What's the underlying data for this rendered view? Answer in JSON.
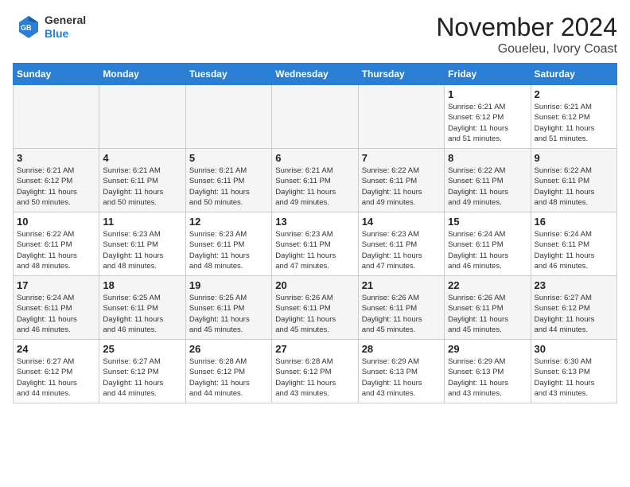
{
  "header": {
    "logo_line1": "General",
    "logo_line2": "Blue",
    "month": "November 2024",
    "location": "Goueleu, Ivory Coast"
  },
  "days_of_week": [
    "Sunday",
    "Monday",
    "Tuesday",
    "Wednesday",
    "Thursday",
    "Friday",
    "Saturday"
  ],
  "weeks": [
    [
      {
        "day": "",
        "info": ""
      },
      {
        "day": "",
        "info": ""
      },
      {
        "day": "",
        "info": ""
      },
      {
        "day": "",
        "info": ""
      },
      {
        "day": "",
        "info": ""
      },
      {
        "day": "1",
        "info": "Sunrise: 6:21 AM\nSunset: 6:12 PM\nDaylight: 11 hours\nand 51 minutes."
      },
      {
        "day": "2",
        "info": "Sunrise: 6:21 AM\nSunset: 6:12 PM\nDaylight: 11 hours\nand 51 minutes."
      }
    ],
    [
      {
        "day": "3",
        "info": "Sunrise: 6:21 AM\nSunset: 6:12 PM\nDaylight: 11 hours\nand 50 minutes."
      },
      {
        "day": "4",
        "info": "Sunrise: 6:21 AM\nSunset: 6:11 PM\nDaylight: 11 hours\nand 50 minutes."
      },
      {
        "day": "5",
        "info": "Sunrise: 6:21 AM\nSunset: 6:11 PM\nDaylight: 11 hours\nand 50 minutes."
      },
      {
        "day": "6",
        "info": "Sunrise: 6:21 AM\nSunset: 6:11 PM\nDaylight: 11 hours\nand 49 minutes."
      },
      {
        "day": "7",
        "info": "Sunrise: 6:22 AM\nSunset: 6:11 PM\nDaylight: 11 hours\nand 49 minutes."
      },
      {
        "day": "8",
        "info": "Sunrise: 6:22 AM\nSunset: 6:11 PM\nDaylight: 11 hours\nand 49 minutes."
      },
      {
        "day": "9",
        "info": "Sunrise: 6:22 AM\nSunset: 6:11 PM\nDaylight: 11 hours\nand 48 minutes."
      }
    ],
    [
      {
        "day": "10",
        "info": "Sunrise: 6:22 AM\nSunset: 6:11 PM\nDaylight: 11 hours\nand 48 minutes."
      },
      {
        "day": "11",
        "info": "Sunrise: 6:23 AM\nSunset: 6:11 PM\nDaylight: 11 hours\nand 48 minutes."
      },
      {
        "day": "12",
        "info": "Sunrise: 6:23 AM\nSunset: 6:11 PM\nDaylight: 11 hours\nand 48 minutes."
      },
      {
        "day": "13",
        "info": "Sunrise: 6:23 AM\nSunset: 6:11 PM\nDaylight: 11 hours\nand 47 minutes."
      },
      {
        "day": "14",
        "info": "Sunrise: 6:23 AM\nSunset: 6:11 PM\nDaylight: 11 hours\nand 47 minutes."
      },
      {
        "day": "15",
        "info": "Sunrise: 6:24 AM\nSunset: 6:11 PM\nDaylight: 11 hours\nand 46 minutes."
      },
      {
        "day": "16",
        "info": "Sunrise: 6:24 AM\nSunset: 6:11 PM\nDaylight: 11 hours\nand 46 minutes."
      }
    ],
    [
      {
        "day": "17",
        "info": "Sunrise: 6:24 AM\nSunset: 6:11 PM\nDaylight: 11 hours\nand 46 minutes."
      },
      {
        "day": "18",
        "info": "Sunrise: 6:25 AM\nSunset: 6:11 PM\nDaylight: 11 hours\nand 46 minutes."
      },
      {
        "day": "19",
        "info": "Sunrise: 6:25 AM\nSunset: 6:11 PM\nDaylight: 11 hours\nand 45 minutes."
      },
      {
        "day": "20",
        "info": "Sunrise: 6:26 AM\nSunset: 6:11 PM\nDaylight: 11 hours\nand 45 minutes."
      },
      {
        "day": "21",
        "info": "Sunrise: 6:26 AM\nSunset: 6:11 PM\nDaylight: 11 hours\nand 45 minutes."
      },
      {
        "day": "22",
        "info": "Sunrise: 6:26 AM\nSunset: 6:11 PM\nDaylight: 11 hours\nand 45 minutes."
      },
      {
        "day": "23",
        "info": "Sunrise: 6:27 AM\nSunset: 6:12 PM\nDaylight: 11 hours\nand 44 minutes."
      }
    ],
    [
      {
        "day": "24",
        "info": "Sunrise: 6:27 AM\nSunset: 6:12 PM\nDaylight: 11 hours\nand 44 minutes."
      },
      {
        "day": "25",
        "info": "Sunrise: 6:27 AM\nSunset: 6:12 PM\nDaylight: 11 hours\nand 44 minutes."
      },
      {
        "day": "26",
        "info": "Sunrise: 6:28 AM\nSunset: 6:12 PM\nDaylight: 11 hours\nand 44 minutes."
      },
      {
        "day": "27",
        "info": "Sunrise: 6:28 AM\nSunset: 6:12 PM\nDaylight: 11 hours\nand 43 minutes."
      },
      {
        "day": "28",
        "info": "Sunrise: 6:29 AM\nSunset: 6:13 PM\nDaylight: 11 hours\nand 43 minutes."
      },
      {
        "day": "29",
        "info": "Sunrise: 6:29 AM\nSunset: 6:13 PM\nDaylight: 11 hours\nand 43 minutes."
      },
      {
        "day": "30",
        "info": "Sunrise: 6:30 AM\nSunset: 6:13 PM\nDaylight: 11 hours\nand 43 minutes."
      }
    ]
  ]
}
